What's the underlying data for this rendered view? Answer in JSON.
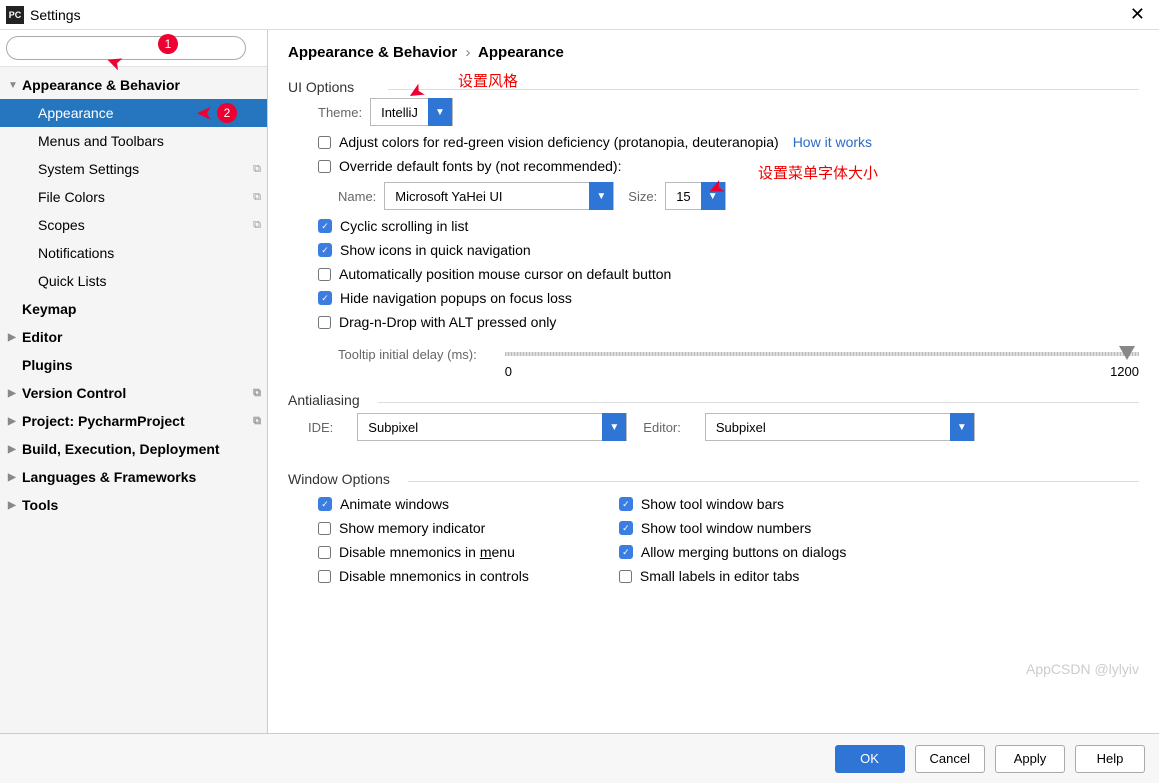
{
  "window": {
    "title": "Settings"
  },
  "search": {
    "placeholder": ""
  },
  "sidebar": {
    "items": [
      {
        "label": "Appearance & Behavior",
        "bold": true,
        "arrow": "▼"
      },
      {
        "label": "Appearance",
        "child": true,
        "selected": true
      },
      {
        "label": "Menus and Toolbars",
        "child": true
      },
      {
        "label": "System Settings",
        "child": true,
        "arrow": "▶",
        "copy": true
      },
      {
        "label": "File Colors",
        "child": true,
        "copy": true
      },
      {
        "label": "Scopes",
        "child": true,
        "copy": true
      },
      {
        "label": "Notifications",
        "child": true
      },
      {
        "label": "Quick Lists",
        "child": true
      },
      {
        "label": "Keymap",
        "bold": true
      },
      {
        "label": "Editor",
        "bold": true,
        "arrow": "▶"
      },
      {
        "label": "Plugins",
        "bold": true
      },
      {
        "label": "Version Control",
        "bold": true,
        "arrow": "▶",
        "copy": true
      },
      {
        "label": "Project: PycharmProject",
        "bold": true,
        "arrow": "▶",
        "copy": true
      },
      {
        "label": "Build, Execution, Deployment",
        "bold": true,
        "arrow": "▶"
      },
      {
        "label": "Languages & Frameworks",
        "bold": true,
        "arrow": "▶"
      },
      {
        "label": "Tools",
        "bold": true,
        "arrow": "▶"
      }
    ]
  },
  "breadcrumb": {
    "parent": "Appearance & Behavior",
    "current": "Appearance"
  },
  "ui": {
    "section": "UI Options",
    "theme_label": "Theme:",
    "theme_value": "IntelliJ",
    "adjust_colors": "Adjust colors for red-green vision deficiency (protanopia, deuteranopia)",
    "how_it_works": "How it works",
    "override_fonts": "Override default fonts by (not recommended):",
    "name_label": "Name:",
    "name_value": "Microsoft YaHei UI",
    "size_label": "Size:",
    "size_value": "15",
    "cyclic": "Cyclic scrolling in list",
    "show_icons": "Show icons in quick navigation",
    "auto_cursor": "Automatically position mouse cursor on default button",
    "hide_nav": "Hide navigation popups on focus loss",
    "dragdrop": "Drag-n-Drop with ALT pressed only",
    "tooltip_label": "Tooltip initial delay (ms):",
    "tooltip_min": "0",
    "tooltip_max": "1200"
  },
  "aa": {
    "section": "Antialiasing",
    "ide_label": "IDE:",
    "ide_value": "Subpixel",
    "editor_label": "Editor:",
    "editor_value": "Subpixel"
  },
  "win": {
    "section": "Window Options",
    "animate": "Animate windows",
    "memory": "Show memory indicator",
    "mnemonics_menu_pre": "Disable mnemonics in ",
    "mnemonics_menu_u": "m",
    "mnemonics_menu_post": "enu",
    "mnemonics_ctrl": "Disable mnemonics in controls",
    "tool_bars": "Show tool window bars",
    "tool_numbers": "Show tool window numbers",
    "merge_buttons": "Allow merging buttons on dialogs",
    "small_labels": "Small labels in editor tabs"
  },
  "footer": {
    "ok": "OK",
    "cancel": "Cancel",
    "apply": "Apply",
    "help": "Help"
  },
  "annotations": {
    "style": "设置风格",
    "font_size": "设置菜单字体大小",
    "badge1": "1",
    "badge2": "2",
    "watermark": "AppCSDN @lylyiv"
  }
}
